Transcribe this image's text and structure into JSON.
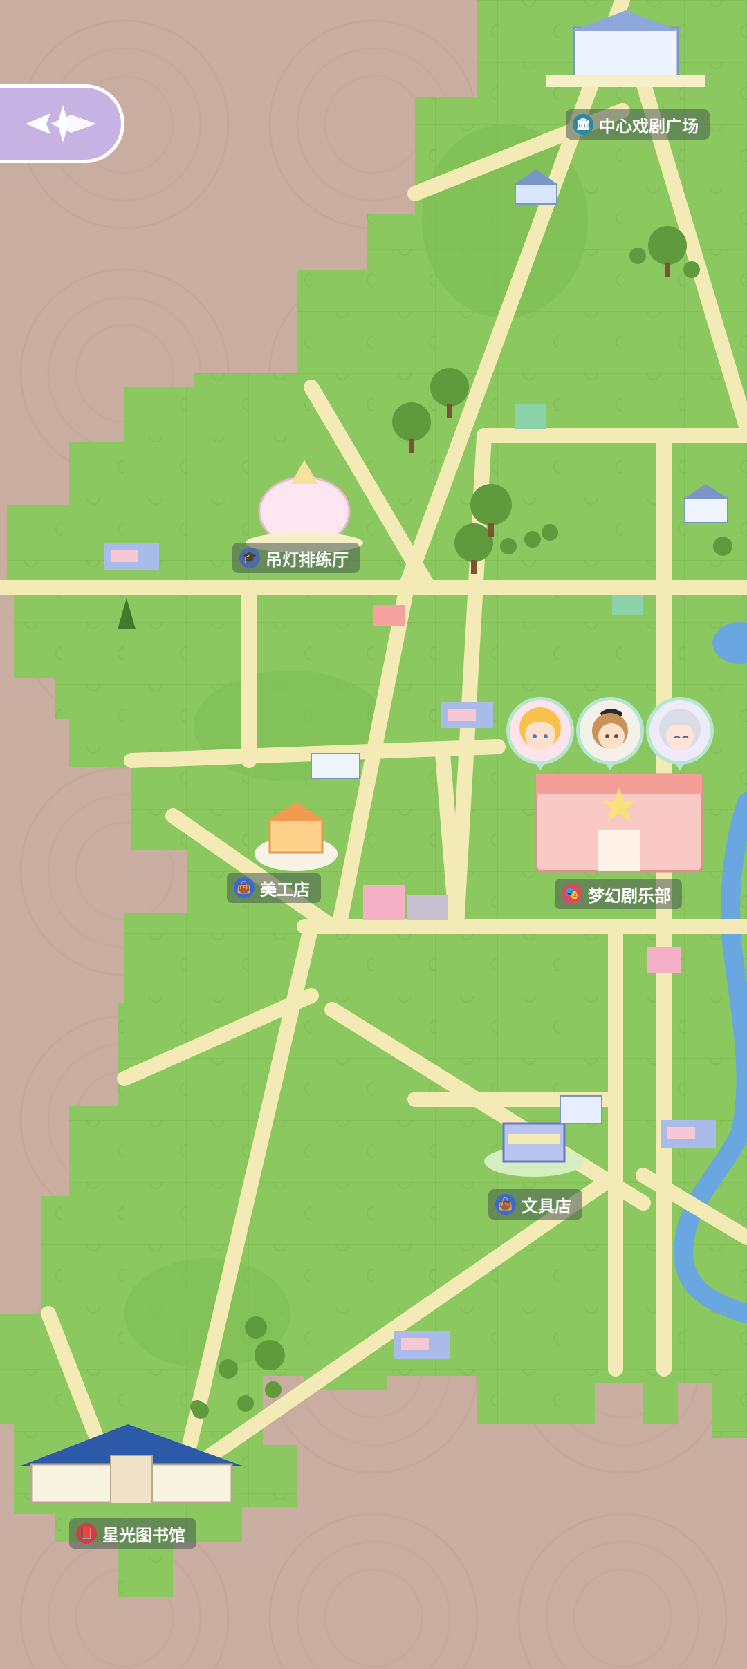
{
  "colors": {
    "background": "#c9ada0",
    "grass": "#8cc860",
    "grass_dark": "#6aac4a",
    "road": "#f3eab5",
    "river": "#6aa6e0",
    "label_bg": "#465a50",
    "accent_purple": "#c7b2e4"
  },
  "back_button": {
    "icon": "compass-arrow-icon"
  },
  "locations": [
    {
      "id": "central-theater-plaza",
      "label": "中心戏剧广场",
      "icon": "bank-icon",
      "icon_color": "#2a8aa6"
    },
    {
      "id": "chandelier-rehearsal-hall",
      "label": "吊灯排练厅",
      "icon": "graduation-cap-icon",
      "icon_color": "#4a6aa8"
    },
    {
      "id": "art-shop",
      "label": "美工店",
      "icon": "shopping-bag-icon",
      "icon_color": "#3a6ad0"
    },
    {
      "id": "dream-drama-club",
      "label": "梦幻剧乐部",
      "icon": "theater-masks-icon",
      "icon_color": "#d05060"
    },
    {
      "id": "stationery-shop",
      "label": "文具店",
      "icon": "shopping-bag-icon",
      "icon_color": "#3a6ad0"
    },
    {
      "id": "starlight-library",
      "label": "星光图书馆",
      "icon": "book-icon",
      "icon_color": "#d04040"
    }
  ],
  "characters": [
    {
      "id": "blonde-girl",
      "icon": "blonde-girl-avatar-icon"
    },
    {
      "id": "brown-hair-girl",
      "icon": "brown-hair-girl-avatar-icon"
    },
    {
      "id": "silver-hair-girl",
      "icon": "silver-hair-girl-avatar-icon"
    }
  ]
}
